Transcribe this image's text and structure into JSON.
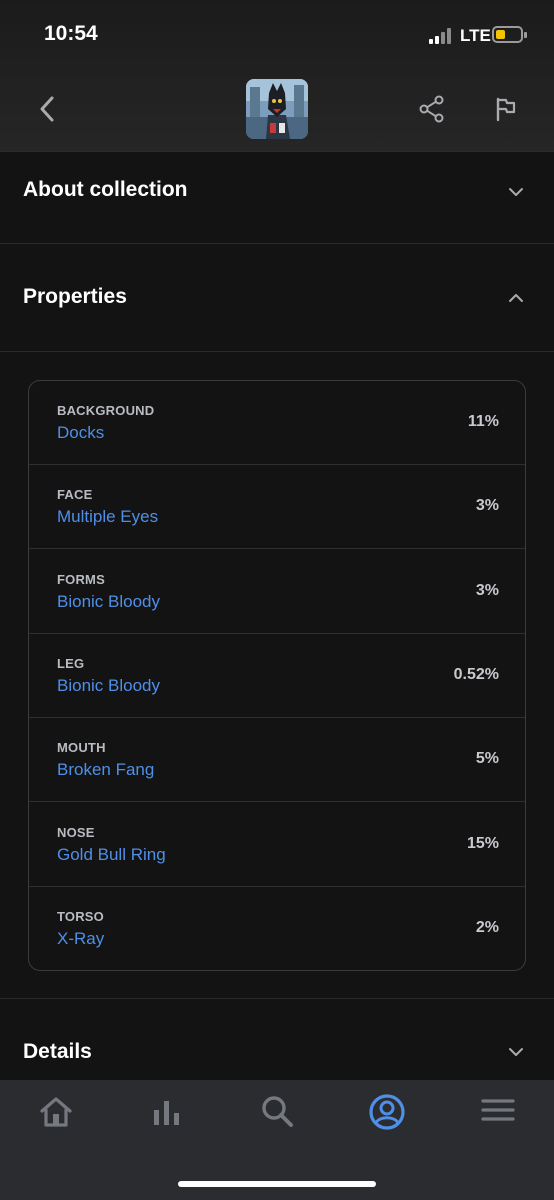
{
  "status_bar": {
    "time": "10:54",
    "network": "LTE"
  },
  "header": {
    "back_icon": "chevron-left-icon",
    "share_icon": "share-icon",
    "flag_icon": "flag-icon"
  },
  "sections": {
    "about": {
      "title": "About collection"
    },
    "properties": {
      "title": "Properties"
    },
    "details": {
      "title": "Details"
    }
  },
  "properties": [
    {
      "type": "BACKGROUND",
      "value": "Docks",
      "rarity": "11%"
    },
    {
      "type": "FACE",
      "value": "Multiple Eyes",
      "rarity": "3%"
    },
    {
      "type": "FORMS",
      "value": "Bionic Bloody",
      "rarity": "3%"
    },
    {
      "type": "LEG",
      "value": "Bionic Bloody",
      "rarity": "0.52%"
    },
    {
      "type": "MOUTH",
      "value": "Broken Fang",
      "rarity": "5%"
    },
    {
      "type": "NOSE",
      "value": "Gold Bull Ring",
      "rarity": "15%"
    },
    {
      "type": "TORSO",
      "value": "X-Ray",
      "rarity": "2%"
    }
  ],
  "bottom_nav": {
    "items": [
      "home-icon",
      "stats-icon",
      "search-icon",
      "profile-icon",
      "menu-icon"
    ],
    "active": "profile-icon"
  },
  "colors": {
    "accent": "#4f8fe8",
    "background": "#131313",
    "nav_background": "#2a2c30",
    "icon_inactive": "#75787e"
  }
}
